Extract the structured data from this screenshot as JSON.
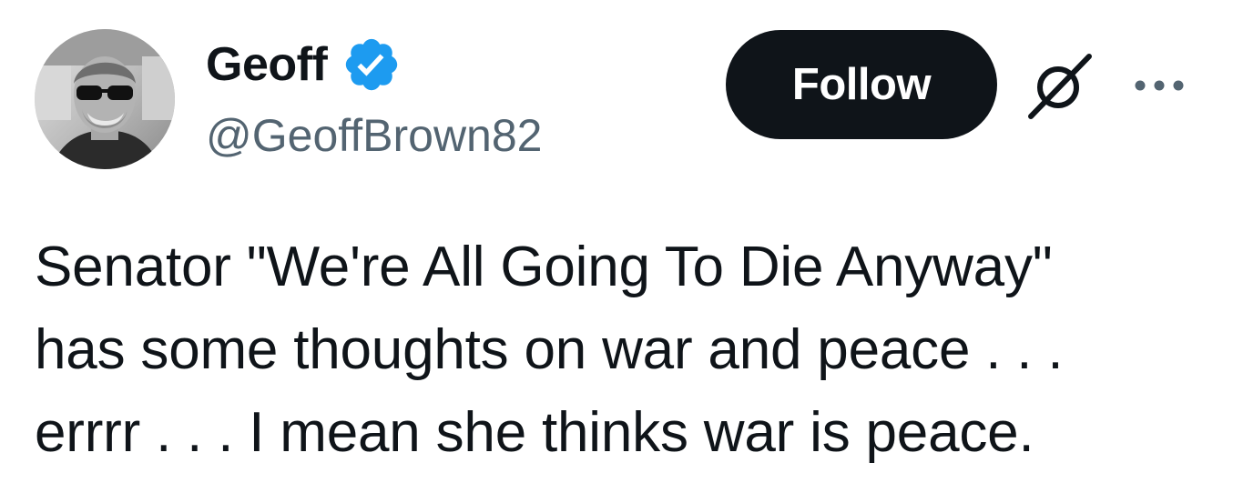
{
  "author": {
    "display_name": "Geoff",
    "handle": "@GeoffBrown82",
    "verified": true,
    "verified_color": "#1d9bf0"
  },
  "actions": {
    "follow_label": "Follow",
    "grok_icon": "grok-slash-icon",
    "more_icon": "more-horizontal-icon"
  },
  "tweet": {
    "lines": [
      "Senator \"We're All Going To Die Anyway\"",
      "has some thoughts on war and peace . . .",
      "errrr . . . I mean she thinks war is peace."
    ]
  },
  "colors": {
    "text_primary": "#0f1419",
    "text_secondary": "#536471",
    "button_bg": "#0f1419",
    "button_text": "#ffffff"
  }
}
